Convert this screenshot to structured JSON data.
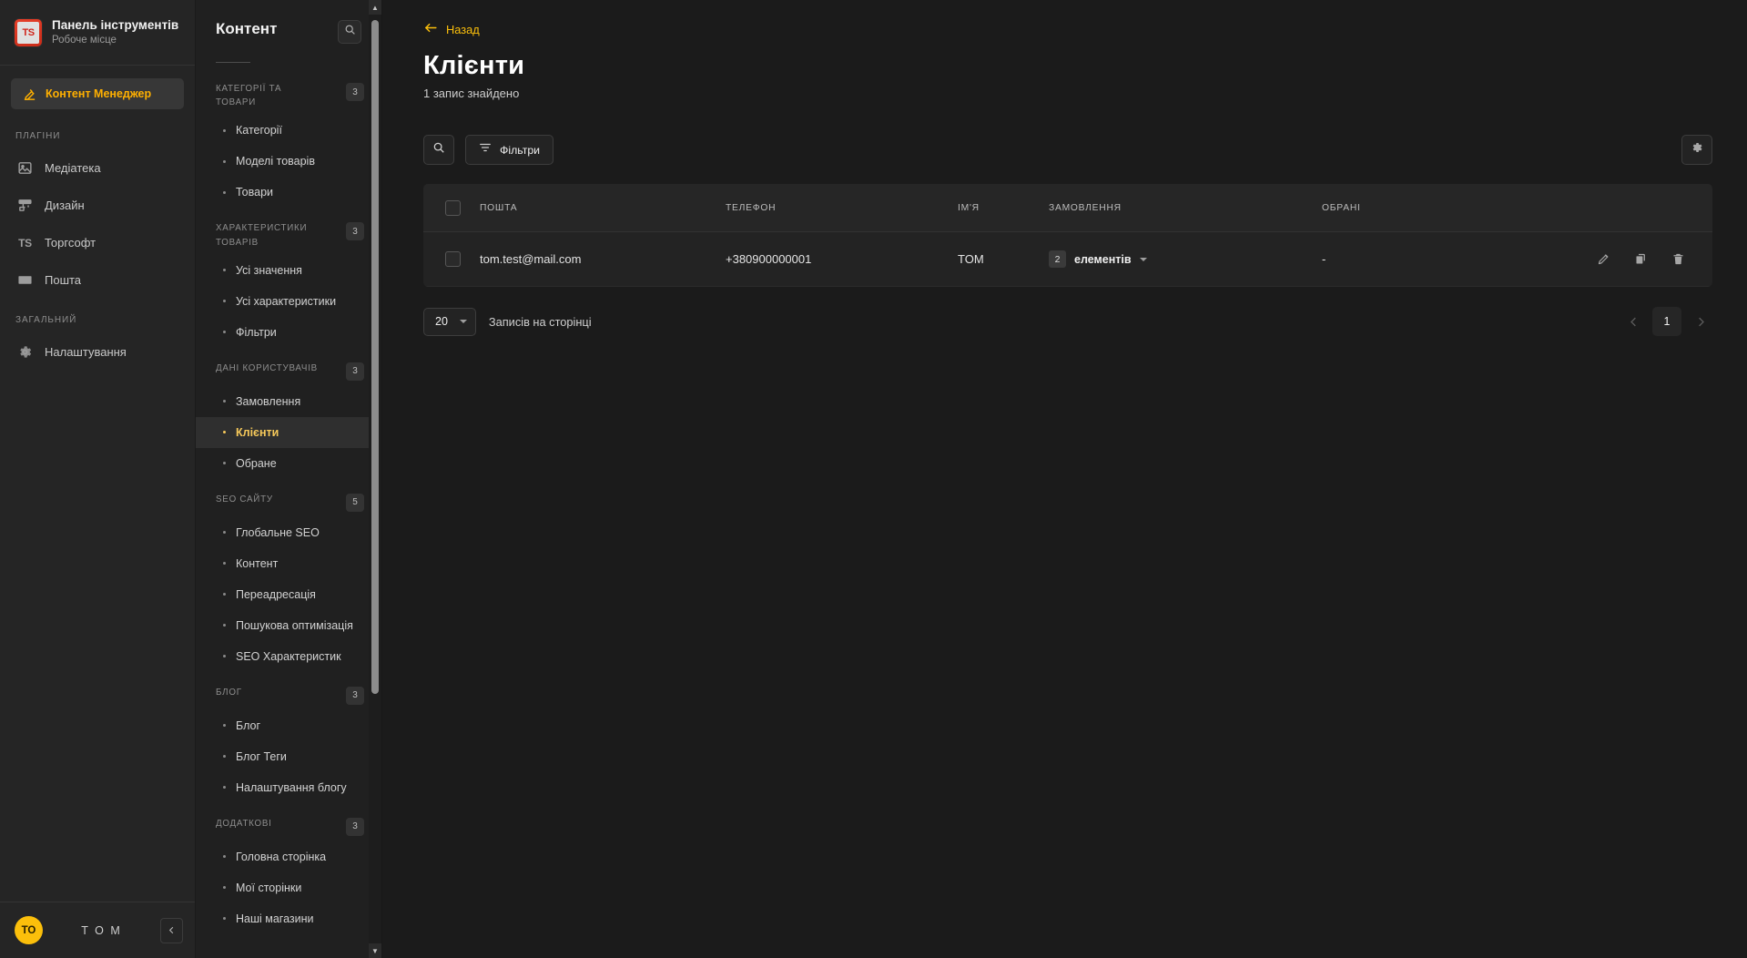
{
  "brand": {
    "logo_text": "TS",
    "title": "Панель інструментів",
    "subtitle": "Робоче місце"
  },
  "left_sidebar": {
    "primary_button": {
      "label": "Контент Менеджер",
      "icon": "pencil-note-icon",
      "accent": "#ffb000"
    },
    "sections": [
      {
        "label": "ПЛАГІНИ",
        "items": [
          {
            "label": "Медіатека",
            "icon": "image-icon"
          },
          {
            "label": "Дизайн",
            "icon": "design-icon"
          },
          {
            "label": "Торгсофт",
            "icon": "ts-icon"
          },
          {
            "label": "Пошта",
            "icon": "mail-icon"
          }
        ]
      },
      {
        "label": "ЗАГАЛЬНИЙ",
        "items": [
          {
            "label": "Налаштування",
            "icon": "gear-icon"
          }
        ]
      }
    ],
    "footer": {
      "avatar_initials": "ТО",
      "username": "T O M",
      "collapse_icon": "chevron-left-icon"
    }
  },
  "nav_panel": {
    "title": "Контент",
    "search_icon": "search-icon",
    "sections": [
      {
        "label": "КАТЕГОРІЇ ТА ТОВАРИ",
        "badge": "3",
        "items": [
          {
            "label": "Категорії",
            "active": false
          },
          {
            "label": "Моделі товарів",
            "active": false
          },
          {
            "label": "Товари",
            "active": false
          }
        ]
      },
      {
        "label": "ХАРАКТЕРИСТИКИ ТОВАРІВ",
        "badge": "3",
        "items": [
          {
            "label": "Усі значення",
            "active": false
          },
          {
            "label": "Усі характеристики",
            "active": false
          },
          {
            "label": "Фільтри",
            "active": false
          }
        ]
      },
      {
        "label": "ДАНІ КОРИСТУВАЧІВ",
        "badge": "3",
        "items": [
          {
            "label": "Замовлення",
            "active": false
          },
          {
            "label": "Клієнти",
            "active": true
          },
          {
            "label": "Обране",
            "active": false
          }
        ]
      },
      {
        "label": "SEO САЙТУ",
        "badge": "5",
        "items": [
          {
            "label": "Глобальне SEO",
            "active": false
          },
          {
            "label": "Контент",
            "active": false
          },
          {
            "label": "Переадресація",
            "active": false
          },
          {
            "label": "Пошукова оптимізація",
            "active": false
          },
          {
            "label": "SEO Характеристик",
            "active": false
          }
        ]
      },
      {
        "label": "БЛОГ",
        "badge": "3",
        "items": [
          {
            "label": "Блог",
            "active": false
          },
          {
            "label": "Блог Теги",
            "active": false
          },
          {
            "label": "Налаштування блогу",
            "active": false
          }
        ]
      },
      {
        "label": "ДОДАТКОВІ",
        "badge": "3",
        "items": [
          {
            "label": "Головна сторінка",
            "active": false
          },
          {
            "label": "Мої сторінки",
            "active": false
          },
          {
            "label": "Наші магазини",
            "active": false
          }
        ]
      }
    ]
  },
  "main": {
    "back_label": "Назад",
    "back_icon": "arrow-left-icon",
    "page_title": "Клієнти",
    "record_count_text": "1 запис знайдено",
    "toolbar": {
      "search_icon": "search-icon",
      "filter_label": "Фільтри",
      "filter_icon": "filter-icon",
      "settings_icon": "gear-icon"
    },
    "table": {
      "columns": [
        "ПОШТА",
        "ТЕЛЕФОН",
        "ІМ'Я",
        "ЗАМОВЛЕННЯ",
        "ОБРАНІ"
      ],
      "rows": [
        {
          "email": "tom.test@mail.com",
          "phone": "+380900000001",
          "name": "TOM",
          "orders_count": "2",
          "orders_label": "елементів",
          "favorites": "-",
          "actions": [
            "edit-icon",
            "duplicate-icon",
            "delete-icon"
          ]
        }
      ]
    },
    "pagination": {
      "per_page_value": "20",
      "per_page_label": "Записів на сторінці",
      "prev_icon": "chevron-left-icon",
      "next_icon": "chevron-right-icon",
      "current_page": "1"
    }
  }
}
